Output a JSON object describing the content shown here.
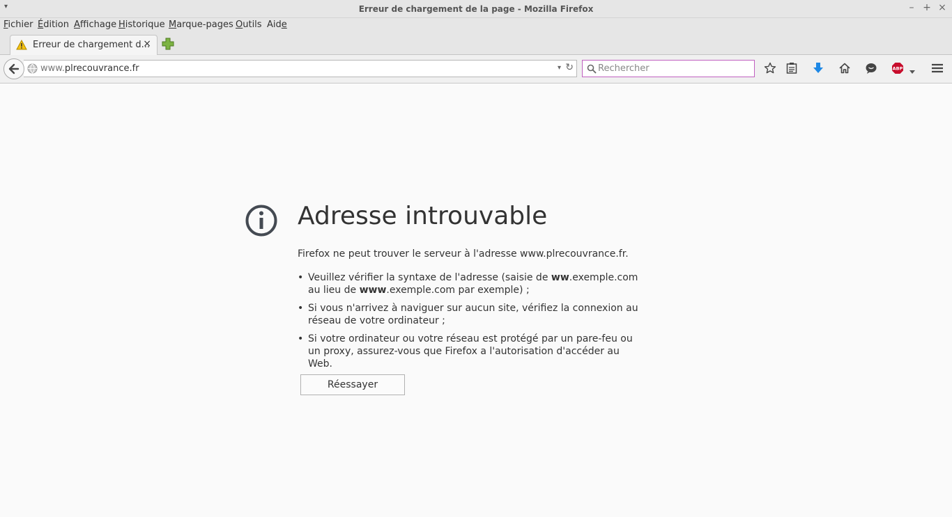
{
  "window": {
    "title": "Erreur de chargement de la page - Mozilla Firefox",
    "menu_arrow": "▾",
    "minimize": "–",
    "maximize": "+",
    "close": "×"
  },
  "menubar": {
    "items": [
      {
        "before": "",
        "ul": "F",
        "after": "ichier"
      },
      {
        "before": "",
        "ul": "É",
        "after": "dition"
      },
      {
        "before": "",
        "ul": "A",
        "after": "ffichage"
      },
      {
        "before": "",
        "ul": "H",
        "after": "istorique"
      },
      {
        "before": "",
        "ul": "M",
        "after": "arque-pages"
      },
      {
        "before": "",
        "ul": "O",
        "after": "utils"
      },
      {
        "before": "Aid",
        "ul": "e",
        "after": ""
      }
    ]
  },
  "tab": {
    "title": "Erreur de chargement d...",
    "close": "×"
  },
  "nav": {
    "url_prefix": "www.",
    "url_domain": "plrecouvrance.fr",
    "url_dropmarker": "▾",
    "reload": "↻",
    "search_placeholder": "Rechercher"
  },
  "error": {
    "title": "Adresse introuvable",
    "description": "Firefox ne peut trouver le serveur à l'adresse www.plrecouvrance.fr.",
    "suggestion1": {
      "a": "Veuillez vérifier la syntaxe de l'adresse (saisie de ",
      "b1": "ww",
      "c": ".exemple.com au lieu de ",
      "b2": "www",
      "d": ".exemple.com par exemple) ;"
    },
    "suggestion2": "Si vous n'arrivez à naviguer sur aucun site, vérifiez la connexion au réseau de votre ordinateur ;",
    "suggestion3": "Si votre ordinateur ou votre réseau est protégé par un pare-feu ou un proxy, assurez-vous que Firefox a l'autorisation d'accéder au Web.",
    "retry_label": "Réessayer"
  },
  "toolbar_icons": [
    "bookmark-star-icon",
    "reading-list-icon",
    "downloads-icon",
    "home-icon",
    "chat-icon",
    "adblock-plus-icon",
    "menu-hamburger-icon"
  ],
  "colors": {
    "download_accent": "#1e88e5",
    "abp_red": "#c70d2c",
    "newtab_green": "#7cb342",
    "search_focus": "#c060c0"
  }
}
